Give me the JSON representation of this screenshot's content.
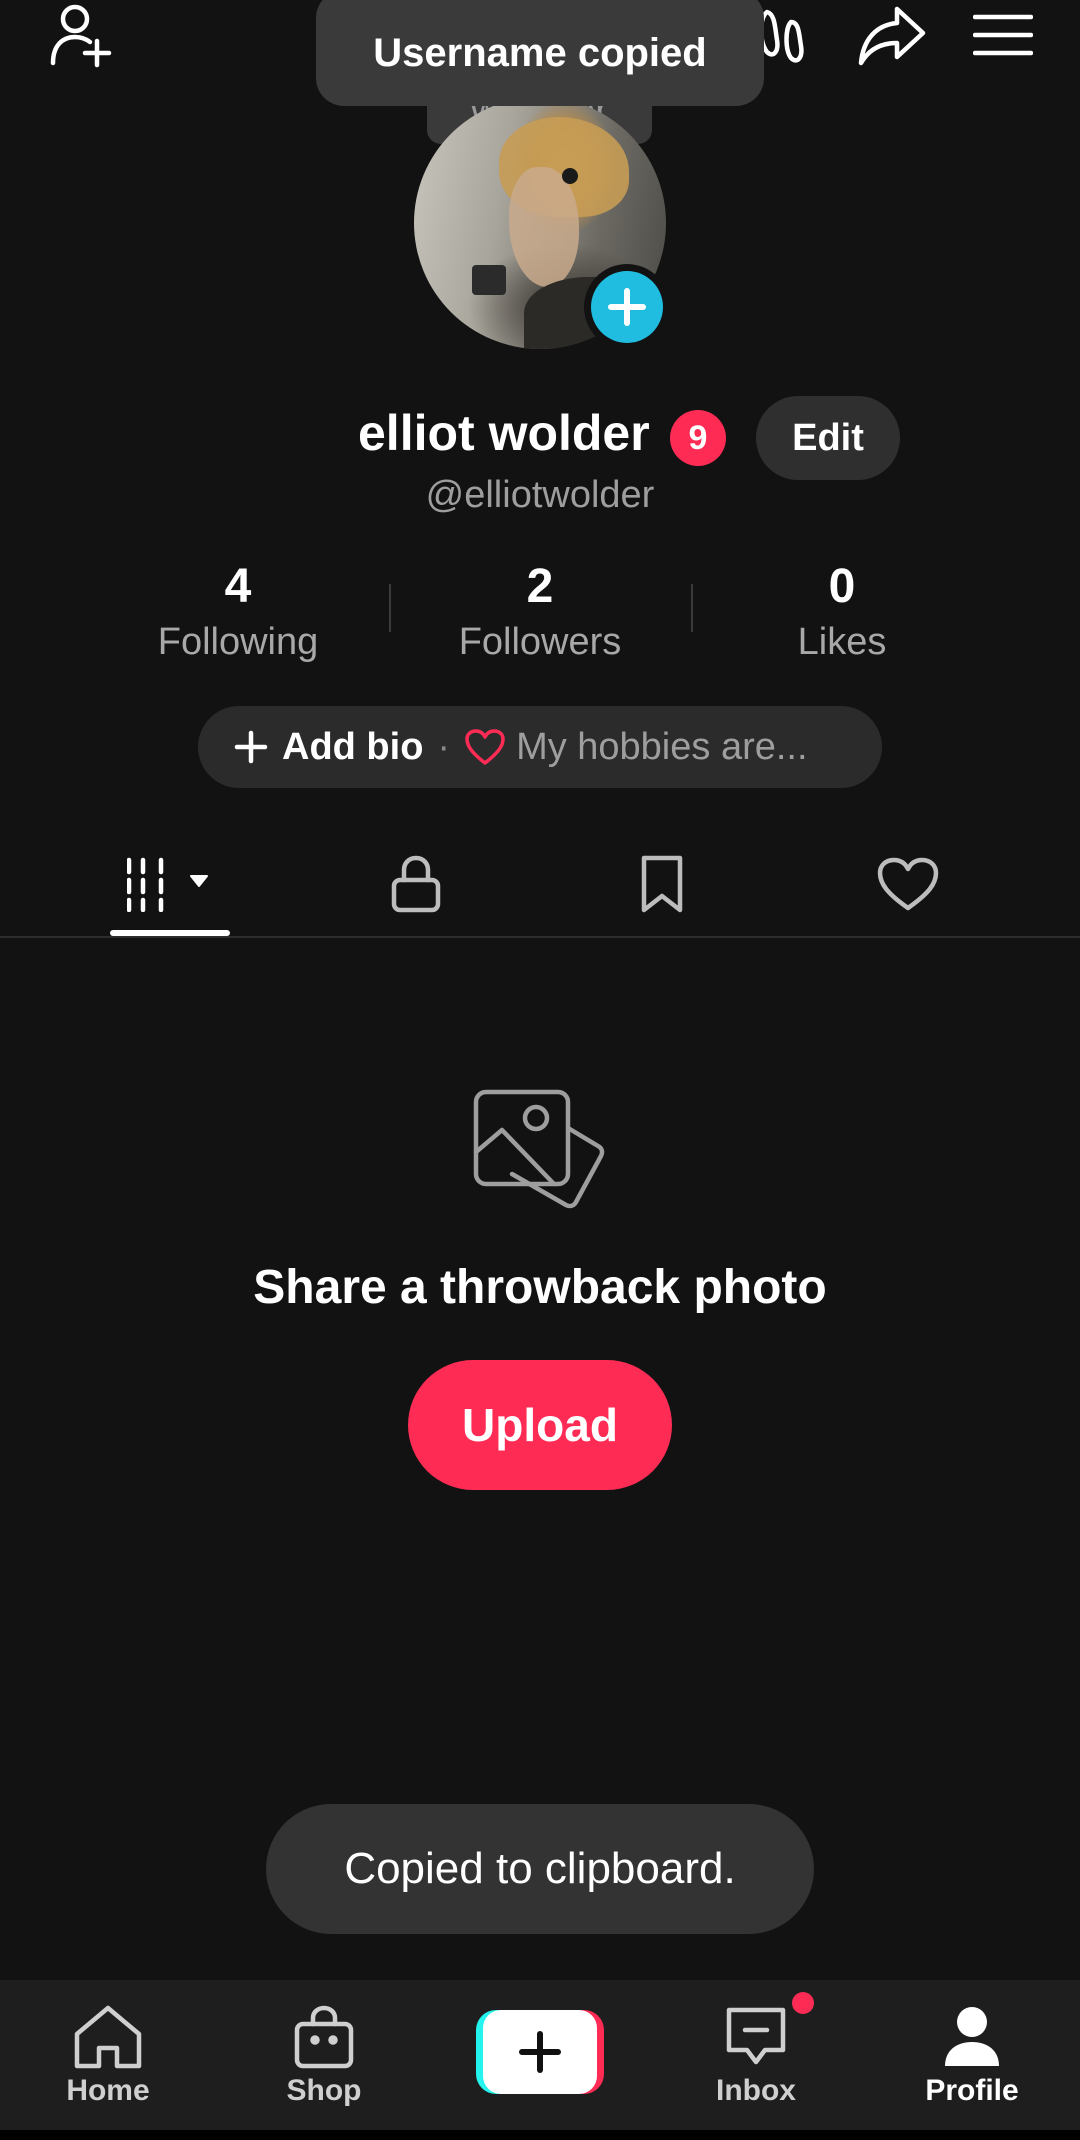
{
  "toasts": {
    "top": "Username copied",
    "bottom": "Copied to clipboard."
  },
  "avatar": {
    "note_label": "whisper"
  },
  "profile": {
    "display_name": "elliot wolder",
    "notification_count": "9",
    "edit_label": "Edit",
    "handle": "@elliotwolder"
  },
  "stats": [
    {
      "value": "4",
      "label": "Following"
    },
    {
      "value": "2",
      "label": "Followers"
    },
    {
      "value": "0",
      "label": "Likes"
    }
  ],
  "bio": {
    "add_label": "Add bio",
    "separator": "·",
    "hint": "My hobbies are..."
  },
  "empty_state": {
    "title": "Share a throwback photo",
    "button": "Upload"
  },
  "nav": [
    {
      "label": "Home"
    },
    {
      "label": "Shop"
    },
    {
      "label": ""
    },
    {
      "label": "Inbox"
    },
    {
      "label": "Profile"
    }
  ],
  "colors": {
    "accent": "#fe2c55",
    "cyan": "#25f4ee",
    "avatar_add": "#20bde1",
    "background": "#121212"
  }
}
